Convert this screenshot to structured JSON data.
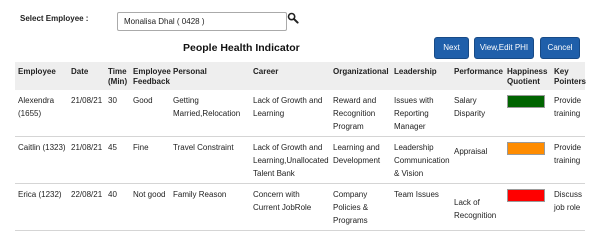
{
  "employee_select": {
    "label": "Select Employee :",
    "value": "Monalisa Dhal ( 0428 )"
  },
  "page_title": "People Health Indicator",
  "buttons": {
    "next": "Next",
    "edit_phi": "View,Edit PHI",
    "cancel": "Cancel"
  },
  "colors": {
    "primary_button": "#1f5faa",
    "happiness_green": "#006400",
    "happiness_orange": "#ff8c00",
    "happiness_red": "#ff0000"
  },
  "table": {
    "headers": {
      "employee": "Employee",
      "date": "Date",
      "time_min": "Time (Min)",
      "employee_feedback": "Employee Feedback",
      "personal": "Personal",
      "career": "Career",
      "organizational": "Organizational",
      "leadership": "Leadership",
      "performance": "Performance",
      "happiness_quotient": "Happiness Quotient",
      "key_pointers": "Key Pointers"
    },
    "rows": [
      {
        "employee": "Alexendra (1655)",
        "date": "21/08/21",
        "time": "30",
        "feedback": "Good",
        "personal": "Getting Married,Relocation",
        "career": "Lack of Growth and Learning",
        "organizational": "Reward and Recognition Program",
        "leadership": "Issues with Reporting Manager",
        "performance": "Salary Disparity",
        "happiness_color": "#006400",
        "key_pointers": "Provide training"
      },
      {
        "employee": "Caitlin (1323)",
        "date": "21/08/21",
        "time": "45",
        "feedback": "Fine",
        "personal": "Travel Constraint",
        "career": "Lack of Growth and Learning,Unallocated Talent Bank",
        "organizational": "Learning and Development",
        "leadership": "Leadership Communication & Vision",
        "performance": "Appraisal",
        "happiness_color": "#ff8c00",
        "key_pointers": "Provide training"
      },
      {
        "employee": "Erica (1232)",
        "date": "22/08/21",
        "time": "40",
        "feedback": "Not good",
        "personal": "Family Reason",
        "career": "Concern with Current JobRole",
        "organizational": "Company Policies & Programs",
        "leadership": "Team Issues",
        "performance": "Lack of Recognition",
        "happiness_color": "#ff0000",
        "key_pointers": "Discuss job role"
      }
    ]
  }
}
